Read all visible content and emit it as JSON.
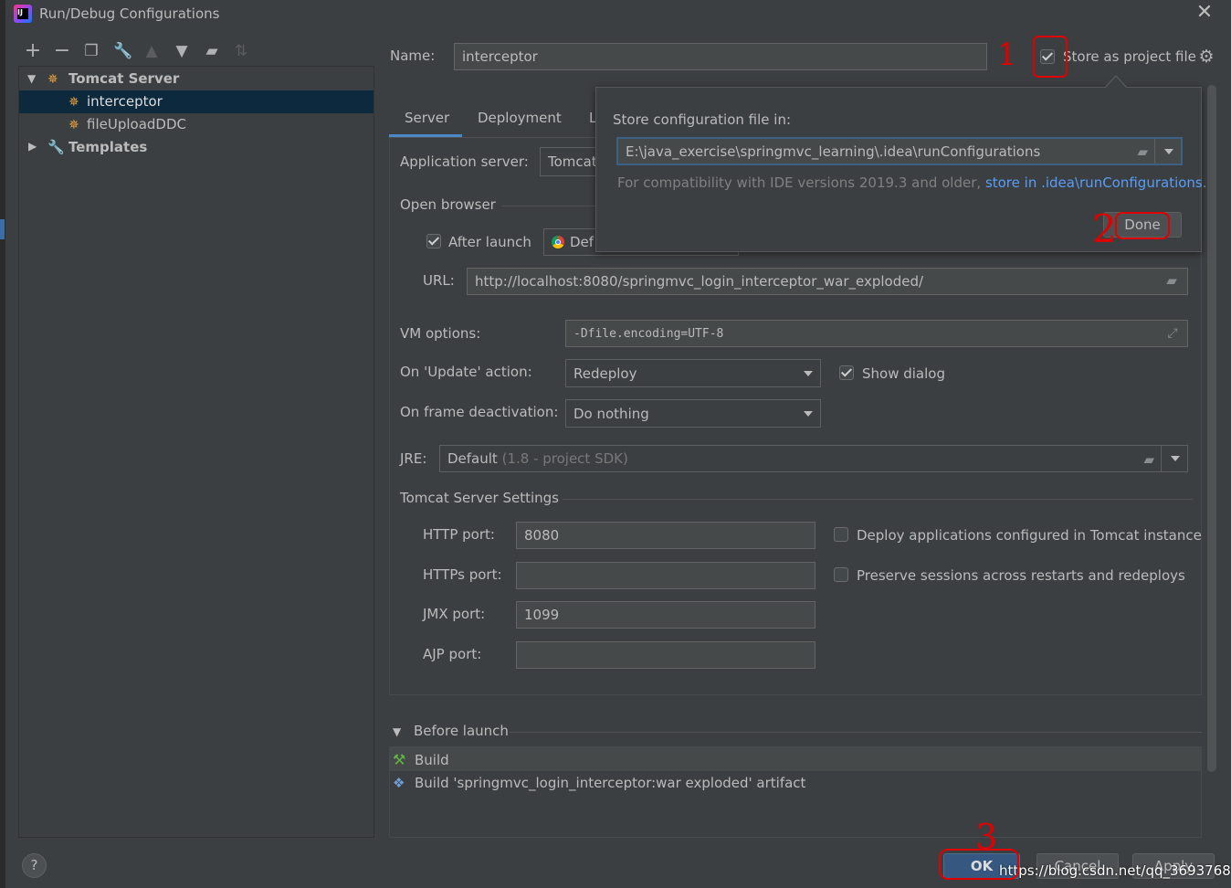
{
  "window": {
    "title": "Run/Debug Configurations"
  },
  "toolbar": {
    "icons": [
      "add-icon",
      "remove-icon",
      "copy-icon",
      "wrench-icon",
      "move-up-icon",
      "move-down-icon",
      "folder-icon",
      "sort-icon"
    ]
  },
  "tree": {
    "group": "Tomcat Server",
    "items": [
      "interceptor",
      "fileUploadDDC"
    ],
    "templates": "Templates"
  },
  "name_label": "Name:",
  "name_value": "interceptor",
  "store_label": "Store as project file",
  "tabs": [
    "Server",
    "Deployment",
    "L"
  ],
  "app_server": {
    "label": "Application server:",
    "value": "Tomcat"
  },
  "open_browser": {
    "title": "Open browser",
    "after_launch": "After launch",
    "browser": "Def",
    "url_label": "URL:",
    "url": "http://localhost:8080/springmvc_login_interceptor_war_exploded/"
  },
  "vm": {
    "label": "VM options:",
    "value": "-Dfile.encoding=UTF-8"
  },
  "update": {
    "label": "On 'Update' action:",
    "value": "Redeploy",
    "show_dialog": "Show dialog"
  },
  "frame": {
    "label": "On frame deactivation:",
    "value": "Do nothing"
  },
  "jre": {
    "label": "JRE:",
    "value": "Default",
    "hint": "(1.8 - project SDK)"
  },
  "tomcat_settings": {
    "title": "Tomcat Server Settings",
    "http_label": "HTTP port:",
    "http": "8080",
    "https_label": "HTTPs port:",
    "https": "",
    "jmx_label": "JMX port:",
    "jmx": "1099",
    "ajp_label": "AJP port:",
    "ajp": "",
    "deploy_cb": "Deploy applications configured in Tomcat instance",
    "preserve_cb": "Preserve sessions across restarts and redeploys"
  },
  "before_launch": {
    "title": "Before launch",
    "items": [
      "Build",
      "Build 'springmvc_login_interceptor:war exploded' artifact"
    ]
  },
  "popup": {
    "title": "Store configuration file in:",
    "path": "E:\\java_exercise\\springmvc_learning\\.idea\\runConfigurations",
    "note_prefix": "For compatibility with IDE versions 2019.3 and older, ",
    "note_link": "store in .idea\\runConfigurations",
    "note_suffix": ".",
    "done": "Done"
  },
  "footer": {
    "help": "?",
    "ok": "OK",
    "cancel": "Cancel",
    "apply": "Apply"
  },
  "watermark": "https://blog.csdn.net/qq_36937684",
  "annotations": {
    "one": "1",
    "two": "2",
    "three": "3"
  },
  "colors": {
    "accent": "#365880",
    "link": "#589df6",
    "annotation": "#e00000"
  }
}
